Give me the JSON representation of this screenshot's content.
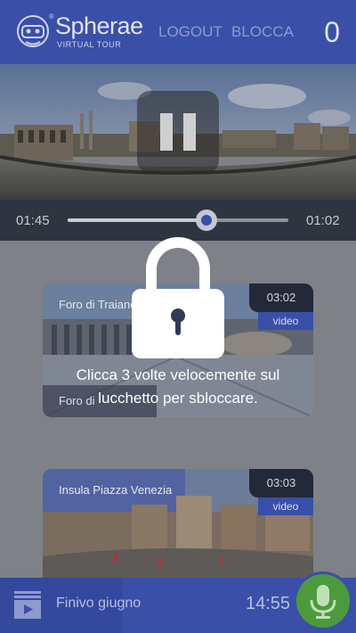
{
  "header": {
    "brand": "Spherae",
    "brand_sub": "VIRTUAL TOUR",
    "registered": "®",
    "logout_label": "LOGOUT",
    "lock_label": "BLOCCA",
    "counter": "0"
  },
  "player": {
    "elapsed": "01:45",
    "remaining": "01:02",
    "progress_fraction": 0.63
  },
  "videos": [
    {
      "title": "Foro di Traiano",
      "duration": "03:02",
      "tag": "video",
      "subtitle": "Foro di"
    },
    {
      "title": "Insula Piazza Venezia",
      "duration": "03:03",
      "tag": "video"
    }
  ],
  "overlay": {
    "message_line1": "Clicca 3 volte velocemente sul",
    "message_line2": "lucchetto per sbloccare."
  },
  "footer": {
    "label": "Finivo giugno",
    "time": "14:55"
  },
  "colors": {
    "brand_blue": "#3a4fa8",
    "mic_green": "#4c9a3e",
    "dim_overlay": "#7e8187"
  }
}
